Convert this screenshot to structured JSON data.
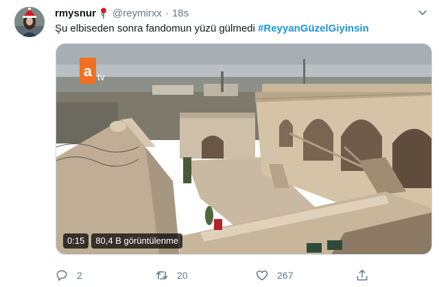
{
  "user": {
    "display_name": "rmysnur",
    "handle": "@reymirxx",
    "separator": "·",
    "time": "18s",
    "avatar_icon": "profile-photo"
  },
  "tweet": {
    "text": "Şu elbiseden sonra fandomun yüzü gülmedi ",
    "hashtag": "#ReyyanGüzelGiyinsin"
  },
  "media": {
    "channel_logo": "atv",
    "duration": "0:15",
    "views": "80,4 B görüntülenme"
  },
  "actions": {
    "replies": "2",
    "retweets": "20",
    "likes": "267"
  },
  "colors": {
    "link": "#1b95e0",
    "muted": "#657786",
    "text": "#14171a"
  }
}
